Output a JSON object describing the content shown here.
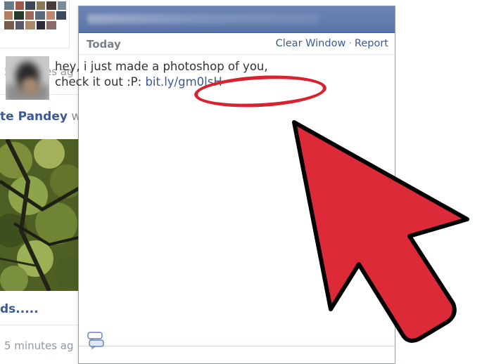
{
  "feed": {
    "time_1": "5 minutes ag",
    "name": "te Pandey",
    "name_suffix": "w",
    "link": "ds.....",
    "time_2": "5 minutes ag"
  },
  "chat": {
    "today_label": "Today",
    "actions": {
      "clear_window": "Clear Window",
      "separator": "·",
      "report": "Report"
    },
    "message": {
      "text": "hey, i just made a photoshop of you, check it out :P:",
      "link": "bit.ly/gm0lsH"
    }
  },
  "icons": {
    "chat_bubble": "chat-bubble-icon",
    "arrow": "pointer-arrow"
  },
  "colors": {
    "accent": "#3b5998",
    "highlight": "#d8232f",
    "arrow": "#dc2a38"
  }
}
